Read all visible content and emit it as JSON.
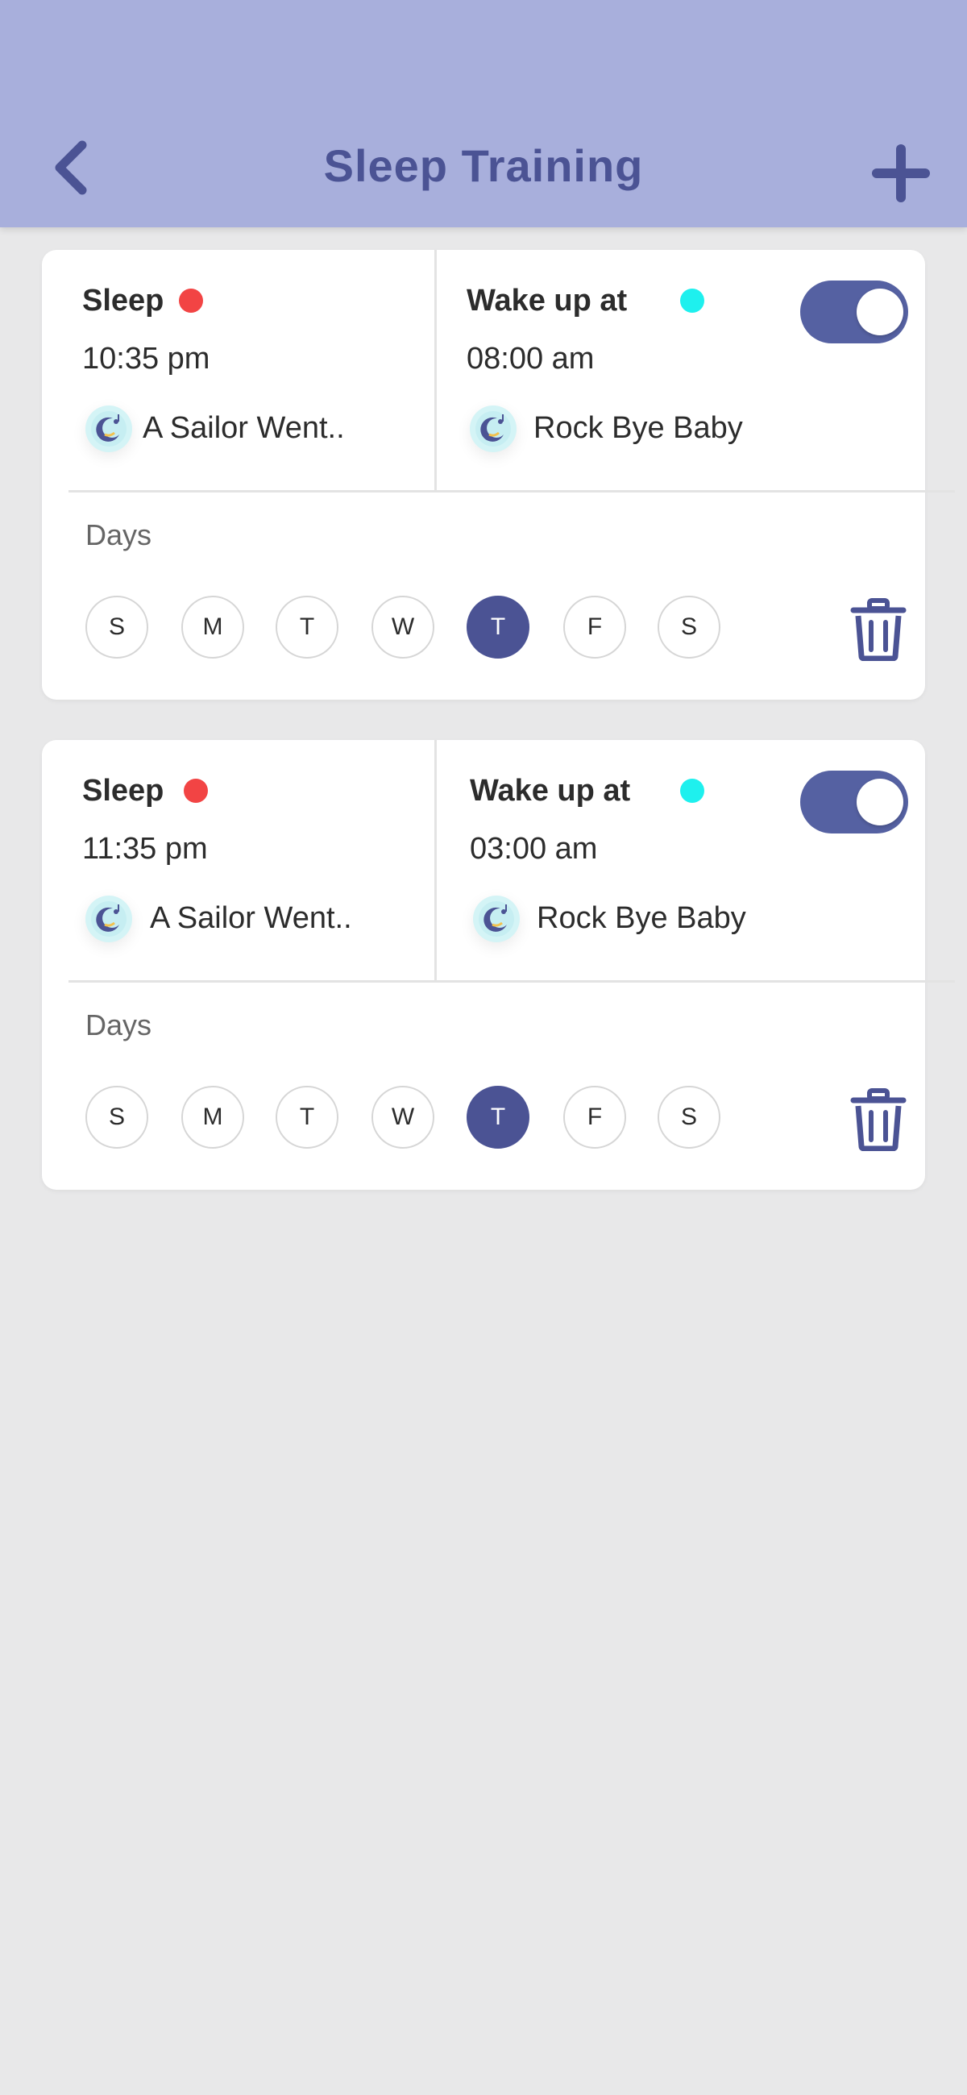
{
  "header": {
    "title": "Sleep Training",
    "back_icon": "chevron-left-icon",
    "add_icon": "plus-icon"
  },
  "colors": {
    "header_bg": "#a8afdc",
    "accent": "#4b5394",
    "sleep_dot": "#f24444",
    "wake_dot": "#1ef0ee",
    "background": "#e8e8e9"
  },
  "alarms": [
    {
      "sleep_label": "Sleep",
      "sleep_time": "10:35 pm",
      "sleep_song": "A Sailor Went..",
      "wake_label": "Wake up at",
      "wake_time": "08:00 am",
      "wake_song": "Rock Bye Baby",
      "enabled": true,
      "days_label": "Days",
      "days": [
        "S",
        "M",
        "T",
        "W",
        "T",
        "F",
        "S"
      ],
      "active_day_index": 4
    },
    {
      "sleep_label": "Sleep",
      "sleep_time": "11:35 pm",
      "sleep_song": "A Sailor Went..",
      "wake_label": "Wake up at",
      "wake_time": "03:00 am",
      "wake_song": "Rock Bye Baby",
      "enabled": true,
      "days_label": "Days",
      "days": [
        "S",
        "M",
        "T",
        "W",
        "T",
        "F",
        "S"
      ],
      "active_day_index": 4
    }
  ]
}
